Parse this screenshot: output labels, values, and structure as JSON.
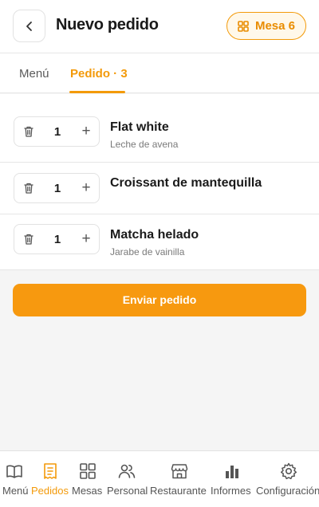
{
  "header": {
    "title": "Nuevo pedido",
    "back_icon": "chevron-left-icon",
    "table_button_label": "Mesa 6",
    "table_icon": "grid-icon"
  },
  "colors": {
    "accent": "#f39a0a",
    "primary_button": "#f7990f",
    "text": "#1a1a1a",
    "muted": "#7a7a7a"
  },
  "tabs": [
    {
      "label": "Menú",
      "active": false
    },
    {
      "label": "Pedido · 3",
      "active": true
    }
  ],
  "order_items": [
    {
      "quantity": "1",
      "name": "Flat white",
      "note": "Leche de avena"
    },
    {
      "quantity": "1",
      "name": "Croissant de mantequilla",
      "note": ""
    },
    {
      "quantity": "1",
      "name": "Matcha helado",
      "note": "Jarabe de vainilla"
    }
  ],
  "actions": {
    "send_label": "Enviar pedido"
  },
  "bottom_nav": [
    {
      "label": "Menú",
      "icon": "book-icon",
      "active": false
    },
    {
      "label": "Pedidos",
      "icon": "receipt-icon",
      "active": true
    },
    {
      "label": "Mesas",
      "icon": "grid-icon",
      "active": false
    },
    {
      "label": "Personal",
      "icon": "people-icon",
      "active": false
    },
    {
      "label": "Restaurante",
      "icon": "storefront-icon",
      "active": false
    },
    {
      "label": "Informes",
      "icon": "bar-chart-icon",
      "active": false
    },
    {
      "label": "Configuración",
      "icon": "gear-icon",
      "active": false
    }
  ]
}
